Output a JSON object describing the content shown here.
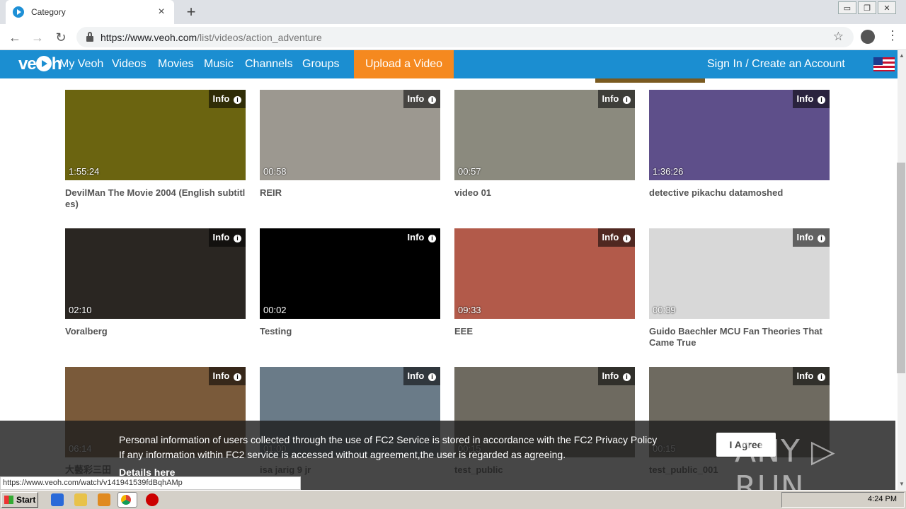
{
  "browser": {
    "tab_title": "Category",
    "tab_close": "×",
    "new_tab": "+",
    "url_host": "https://www.veoh.com",
    "url_path": "/list/videos/action_adventure",
    "back": "←",
    "forward": "→",
    "reload": "↻",
    "bookmark": "☆",
    "menu": "⋮",
    "window_controls": [
      "▭",
      "❐",
      "✕"
    ]
  },
  "site_nav": {
    "logo": "veoh",
    "items": [
      "My Veoh",
      "Videos",
      "Movies",
      "Music",
      "Channels",
      "Groups"
    ],
    "upload": "Upload a Video",
    "signin": "Sign In / Create an Account"
  },
  "videos": [
    {
      "title": "DevilMan The Movie 2004 (English subtitles)",
      "duration": "1:55:24",
      "thumb": "#6b6410",
      "info": "Info"
    },
    {
      "title": "REIR",
      "duration": "00:58",
      "thumb": "#9c9890",
      "info": "Info"
    },
    {
      "title": "video 01",
      "duration": "00:57",
      "thumb": "#8b8a7e",
      "info": "Info"
    },
    {
      "title": "detective pikachu datamoshed",
      "duration": "1:36:26",
      "thumb": "#5e4f8a",
      "info": "Info"
    },
    {
      "title": "Voralberg",
      "duration": "02:10",
      "thumb": "#2a2622",
      "info": "Info"
    },
    {
      "title": "Testing",
      "duration": "00:02",
      "thumb": "#000000",
      "info": "Info"
    },
    {
      "title": "EEE",
      "duration": "09:33",
      "thumb": "#b25a4a",
      "info": "Info"
    },
    {
      "title": "Guido Baechler MCU Fan Theories That Came True",
      "duration": "00:39",
      "thumb": "#d8d8d8",
      "info": "Info"
    },
    {
      "title": "大藝彩三田",
      "duration": "06:14",
      "thumb": "#7a5a3a",
      "info": "Info"
    },
    {
      "title": "isa jarig 9 jr",
      "duration": "01:00",
      "thumb": "#6a7b88",
      "info": "Info"
    },
    {
      "title": "test_public",
      "duration": "00:15",
      "thumb": "#6e6a60",
      "info": "Info"
    },
    {
      "title": "test_public_001",
      "duration": "00:15",
      "thumb": "#6e6a60",
      "info": "Info"
    }
  ],
  "cookie": {
    "line1": "Personal information of users collected through the use of FC2 Service is stored in accordance with the FC2 Privacy Policy",
    "line2": "If any information within FC2 service is accessed without agreement,the user is regarded as agreeing.",
    "details": "Details here",
    "agree": "I Agree",
    "watermark": "ANY ▷ RUN"
  },
  "status_url": "https://www.veoh.com/watch/v141941539fdBqhAMp",
  "taskbar": {
    "start": "Start",
    "clock": "4:24 PM"
  }
}
